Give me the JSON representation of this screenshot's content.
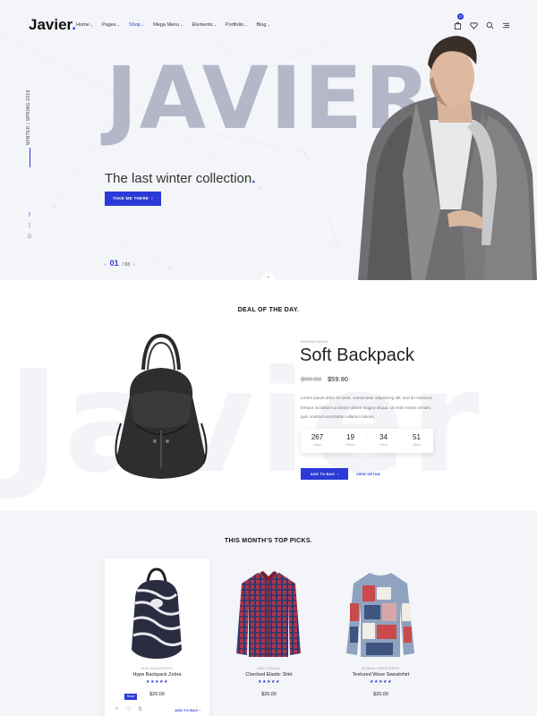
{
  "header": {
    "logo": "Javier",
    "nav": [
      {
        "label": "Home",
        "active": false
      },
      {
        "label": "Pages",
        "active": false
      },
      {
        "label": "Shop",
        "active": true
      },
      {
        "label": "Mega Menu",
        "active": false
      },
      {
        "label": "Elements",
        "active": false
      },
      {
        "label": "Portfolio",
        "active": false
      },
      {
        "label": "Blog",
        "active": false
      }
    ],
    "cart_count": "0",
    "icons": [
      "bag-icon",
      "heart-icon",
      "search-icon",
      "menu-icon"
    ]
  },
  "hero": {
    "big_word": "JAVIER",
    "season": "WINTER / SPRING 2019",
    "tagline": "The last winter collection",
    "button": "TAKE ME THERE",
    "slide_current": "01",
    "slide_total": "/ 03",
    "social": [
      "facebook-icon",
      "twitter-icon",
      "google-icon"
    ]
  },
  "deal": {
    "section_title": "DEAL OF THE DAY",
    "bg_word": "Javier",
    "category": "WOMAN BAGS",
    "name": "Soft Backpack",
    "old_price": "$89.90",
    "new_price": "$59.90",
    "description": "Lorem ipsum dolor sit amet, consectetur adipisicing elit, sed do eiusmod tempor incididunt ut labore dolore magna aliqua. Ut enim minim veniam, quis nostrud exercitation ullamco laboris.",
    "countdown": [
      {
        "value": "267",
        "label": "Days"
      },
      {
        "value": "19",
        "label": "Hours"
      },
      {
        "value": "34",
        "label": "Mins"
      },
      {
        "value": "51",
        "label": "Secs"
      }
    ],
    "add_to_bag": "ADD TO BAG",
    "view_detail": "VIEW DETAIL"
  },
  "picks": {
    "section_title": "THIS MONTH'S TOP PICKS",
    "items": [
      {
        "category": "MAN BACKPACKS",
        "name": "Hype Backpack Zebra",
        "rating": 5,
        "price": "$20.00"
      },
      {
        "category": "MAN CASUAL",
        "name": "Checked Elastic Shirt",
        "rating": 5,
        "price": "$20.00"
      },
      {
        "category": "WOMAN SWEATSHIRT",
        "name": "Textured Wave Sweatshirt",
        "rating": 5,
        "price": "$20.00"
      }
    ],
    "save_tooltip": "Save",
    "add_to_bag": "ADD TO BAG"
  },
  "colors": {
    "accent": "#2b3ad7",
    "hero_bg": "#f4f5f9",
    "hero_word": "#b3b7c8"
  }
}
